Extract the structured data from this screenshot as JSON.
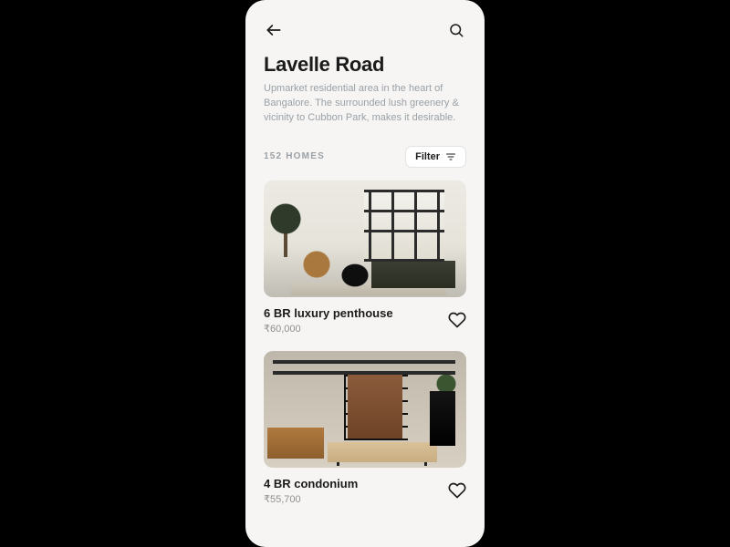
{
  "header": {
    "title": "Lavelle Road",
    "subtitle": "Upmarket residential area in the heart of Bangalore. The surrounded lush greenery & vicinity to Cubbon Park, makes it desirable."
  },
  "meta": {
    "count_label": "152 HOMES",
    "filter_label": "Filter"
  },
  "listings": [
    {
      "title": "6 BR luxury penthouse",
      "price": "₹60,000"
    },
    {
      "title": "4 BR condonium",
      "price": "₹55,700"
    }
  ]
}
